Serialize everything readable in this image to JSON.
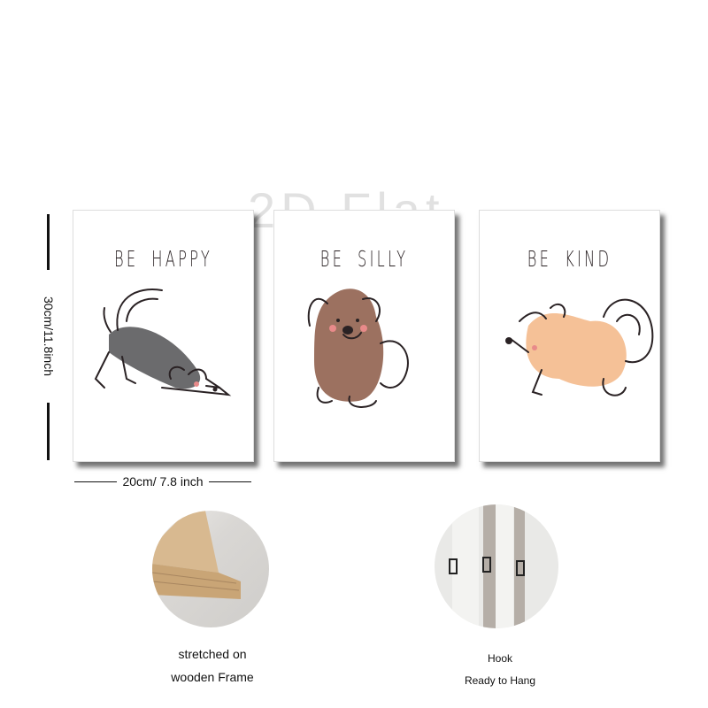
{
  "watermark": "2D Flat",
  "dimensions": {
    "height_label": "30cm/11.8inch",
    "width_label": "20cm/ 7.8 inch"
  },
  "panels": [
    {
      "title": "BE HAPPY",
      "dog_color": "#6b6b6d"
    },
    {
      "title": "BE SILLY",
      "dog_color": "#9c7160"
    },
    {
      "title": "BE KIND",
      "dog_color": "#f5c197"
    }
  ],
  "features": [
    {
      "caption_line1": "stretched on",
      "caption_line2": "wooden Frame"
    },
    {
      "caption_line1": "Hook",
      "caption_line2": "Ready to Hang"
    }
  ]
}
